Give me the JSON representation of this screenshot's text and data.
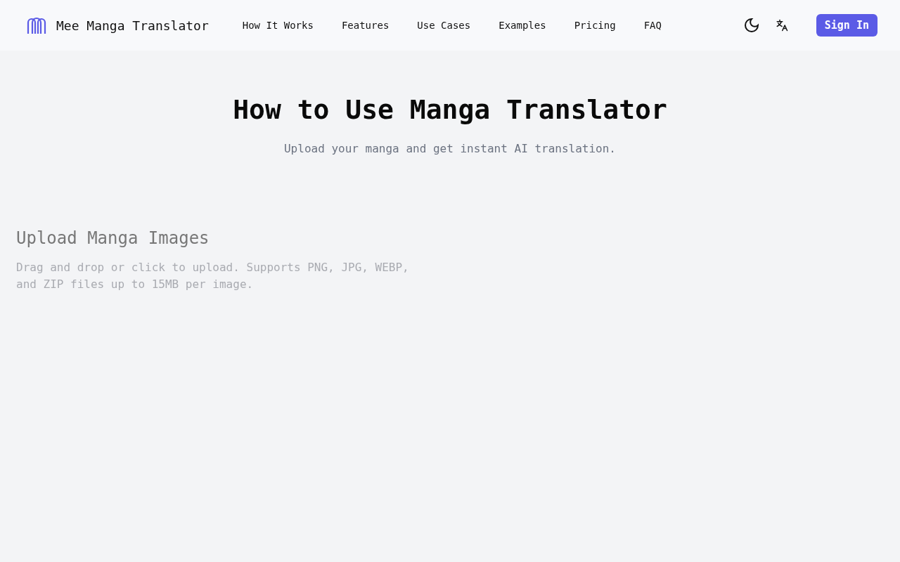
{
  "header": {
    "brand": "Mee Manga Translator",
    "nav": [
      "How It Works",
      "Features",
      "Use Cases",
      "Examples",
      "Pricing",
      "FAQ"
    ],
    "sign_in": "Sign In"
  },
  "hero": {
    "title": "How to Use Manga Translator",
    "subtitle": "Upload your manga and get instant AI translation."
  },
  "upload": {
    "title": "Upload Manga Images",
    "description": "Drag and drop or click to upload. Supports PNG, JPG, WEBP, and ZIP files up to 15MB per image."
  }
}
